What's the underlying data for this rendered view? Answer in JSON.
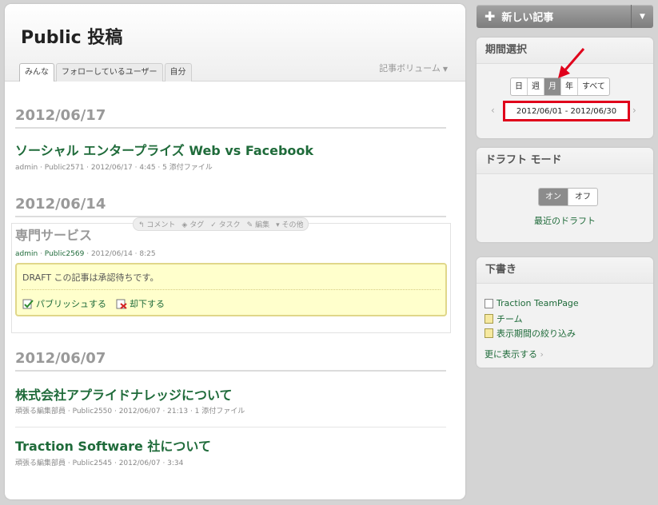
{
  "page": {
    "title": "Public 投稿",
    "tabs": [
      {
        "label": "みんな"
      },
      {
        "label": "フォローしているユーザー"
      },
      {
        "label": "自分"
      }
    ],
    "volume_label": "記事ボリューム"
  },
  "groups": [
    {
      "date": "2012/06/17"
    },
    {
      "date": "2012/06/14"
    },
    {
      "date": "2012/06/07"
    }
  ],
  "posts": [
    {
      "title": "ソーシャル エンタープライズ Web vs Facebook",
      "meta": "admin · Public2571 · 2012/06/17 · 4:45 · 5 添付ファイル"
    },
    {
      "title": "株式会社アプライドナレッジについて",
      "meta": "頑張る編集部員 · Public2550 · 2012/06/07 · 21:13 · 1 添付ファイル"
    },
    {
      "title": "Traction Software 社について",
      "meta": "頑張る編集部員 · Public2545 · 2012/06/07 · 3:34"
    }
  ],
  "draft_post": {
    "title": "専門サービス",
    "author": "admin",
    "id": "Public2569",
    "meta_rest": "· 2012/06/14 · 8:25",
    "toolbar": {
      "comment": "コメント",
      "tag": "タグ",
      "task": "タスク",
      "edit": "編集",
      "more": "その他"
    },
    "approval_text": "DRAFT この記事は承認待ちです。",
    "publish_label": "パブリッシュする",
    "reject_label": "却下する"
  },
  "sidebar": {
    "new_post_label": "新しい記事",
    "period": {
      "title": "期間選択",
      "buttons": [
        "日",
        "週",
        "月",
        "年",
        "すべて"
      ],
      "range": "2012/06/01 - 2012/06/30"
    },
    "draft_mode": {
      "title": "ドラフト モード",
      "on": "オン",
      "off": "オフ",
      "recent_link": "最近のドラフト"
    },
    "drafts": {
      "title": "下書き",
      "items": [
        {
          "label": "Traction TeamPage"
        },
        {
          "label": "チーム"
        },
        {
          "label": "表示期間の絞り込み"
        }
      ],
      "more_label": "更に表示する"
    }
  },
  "colors": {
    "link_green": "#1f6b3a",
    "highlight_red": "#e0001b",
    "approval_bg": "#ffffcc"
  }
}
